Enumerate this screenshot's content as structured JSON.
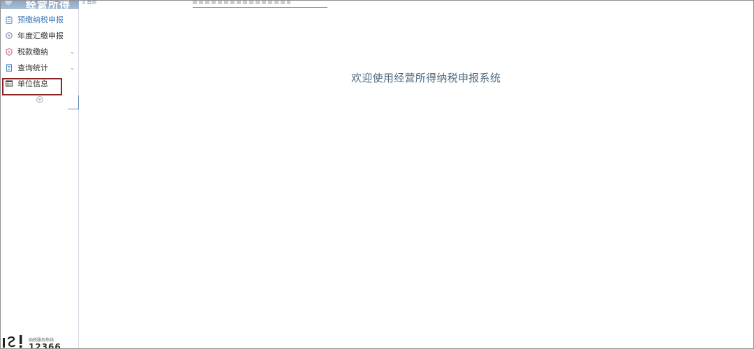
{
  "sidebar": {
    "header_title": "经营所得",
    "items": [
      {
        "label": "预缴纳税申报",
        "icon": "clipboard-icon",
        "active": true,
        "expandable": false
      },
      {
        "label": "年度汇缴申报",
        "icon": "coin-icon",
        "active": false,
        "expandable": false
      },
      {
        "label": "税款缴纳",
        "icon": "shield-icon",
        "active": false,
        "expandable": true
      },
      {
        "label": "查询统计",
        "icon": "document-icon",
        "active": false,
        "expandable": true
      },
      {
        "label": "单位信息",
        "icon": "table-icon",
        "active": false,
        "expandable": false
      }
    ],
    "collapse_symbol": "«",
    "chevron_symbol": "⌄",
    "footer": {
      "hotline_label": "纳税服务热线",
      "hotline_number": "12366"
    }
  },
  "breadcrumb": {
    "home_label": "首页"
  },
  "main": {
    "welcome_text": "欢迎使用经营所得纳税申报系统"
  },
  "colors": {
    "accent": "#3a79b8",
    "highlight_border": "#8b2525",
    "welcome_text": "#4f6a7e"
  }
}
